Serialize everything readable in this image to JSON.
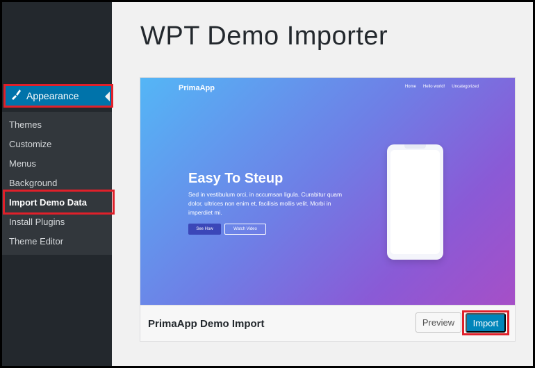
{
  "sidebar": {
    "parent_label": "Appearance",
    "submenu": [
      {
        "label": "Themes"
      },
      {
        "label": "Customize"
      },
      {
        "label": "Menus"
      },
      {
        "label": "Background"
      },
      {
        "label": "Import Demo Data",
        "current": true
      },
      {
        "label": "Install Plugins"
      },
      {
        "label": "Theme Editor"
      }
    ]
  },
  "main": {
    "title": "WPT Demo Importer",
    "theme_card": {
      "name": "PrimaApp Demo Import",
      "preview_label": "Preview",
      "import_label": "Import",
      "screenshot": {
        "logo": "PrimaApp",
        "nav": [
          "Home",
          "Hello world!",
          "Uncategorized"
        ],
        "headline": "Easy To Steup",
        "body": "Sed in vestibulum orci, in accumsan ligula. Curabitur quam dolor, ultrices non enim et, facilisis mollis velit. Morbi in imperdiet mi.",
        "button_primary": "See How",
        "button_secondary": "Watch Video"
      }
    }
  },
  "colors": {
    "sidebar_bg": "#23282d",
    "submenu_bg": "#32373c",
    "active_bg": "#0073aa",
    "import_button": "#0085ba",
    "highlight": "#e0202a"
  }
}
